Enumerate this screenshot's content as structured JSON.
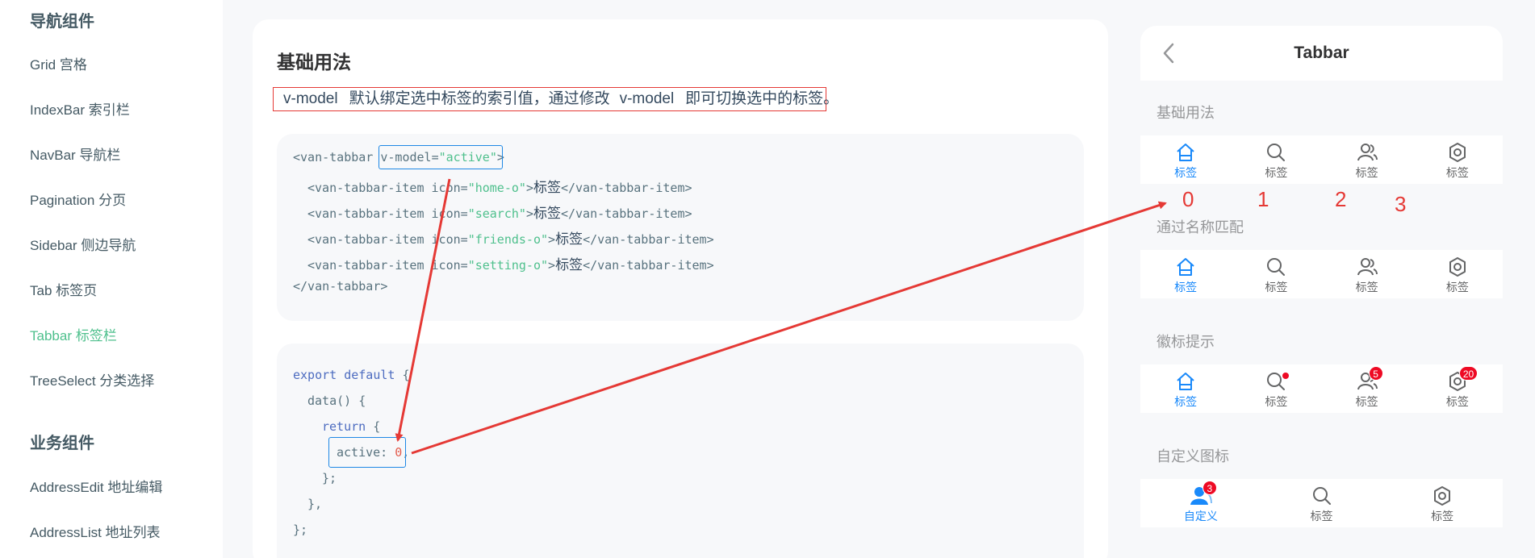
{
  "sidebar": {
    "groups": [
      {
        "title": "导航组件",
        "items": [
          "Grid 宫格",
          "IndexBar 索引栏",
          "NavBar 导航栏",
          "Pagination 分页",
          "Sidebar 侧边导航",
          "Tab 标签页",
          "Tabbar 标签栏",
          "TreeSelect 分类选择"
        ]
      },
      {
        "title": "业务组件",
        "items": [
          "AddressEdit 地址编辑",
          "AddressList 地址列表"
        ]
      }
    ],
    "active_item": "Tabbar 标签栏"
  },
  "doc": {
    "title": "基础用法",
    "desc": {
      "code1": "v-model",
      "text1": "默认绑定选中标签的索引值，通过修改",
      "code2": "v-model",
      "text2": "即可切换选中的标签。"
    },
    "template_code": {
      "line1": {
        "tag_open": "<van-tabbar",
        "attr": "v-model=",
        "value": "\"active\"",
        "close": ">"
      },
      "items": [
        {
          "open": "<van-tabbar-item icon=",
          "value": "\"home-o\"",
          "mid": ">",
          "text": "标签",
          "close": "</van-tabbar-item>"
        },
        {
          "open": "<van-tabbar-item icon=",
          "value": "\"search\"",
          "mid": ">",
          "text": "标签",
          "close": "</van-tabbar-item>"
        },
        {
          "open": "<van-tabbar-item icon=",
          "value": "\"friends-o\"",
          "mid": ">",
          "text": "标签",
          "close": "</van-tabbar-item>"
        },
        {
          "open": "<van-tabbar-item icon=",
          "value": "\"setting-o\"",
          "mid": ">",
          "text": "标签",
          "close": "</van-tabbar-item>"
        }
      ],
      "end": "</van-tabbar>"
    },
    "script_code": {
      "l1_kw": "export default",
      "l1_rest": " {",
      "l2": "data() {",
      "l3_kw": "return",
      "l3_rest": " {",
      "l4_key": "active: ",
      "l4_val": "0",
      "l4_end": ",",
      "l5": "};",
      "l6": "},",
      "l7": "};"
    }
  },
  "phone": {
    "nav_title": "Tabbar",
    "sections": [
      {
        "title": "基础用法"
      },
      {
        "title": "通过名称匹配"
      },
      {
        "title": "徽标提示"
      },
      {
        "title": "自定义图标"
      }
    ],
    "tab_label": "标签",
    "custom_label": "自定义",
    "badges": {
      "search": "",
      "friends": "5",
      "setting": "20",
      "custom": "3"
    },
    "index_annotations": [
      "0",
      "1",
      "2",
      "3"
    ],
    "active_color": "#1989fa",
    "inactive_color": "#646566",
    "badge_color": "#ee0a24"
  },
  "annotation_color": "#e53935",
  "highlight_color": "#1e88e5"
}
